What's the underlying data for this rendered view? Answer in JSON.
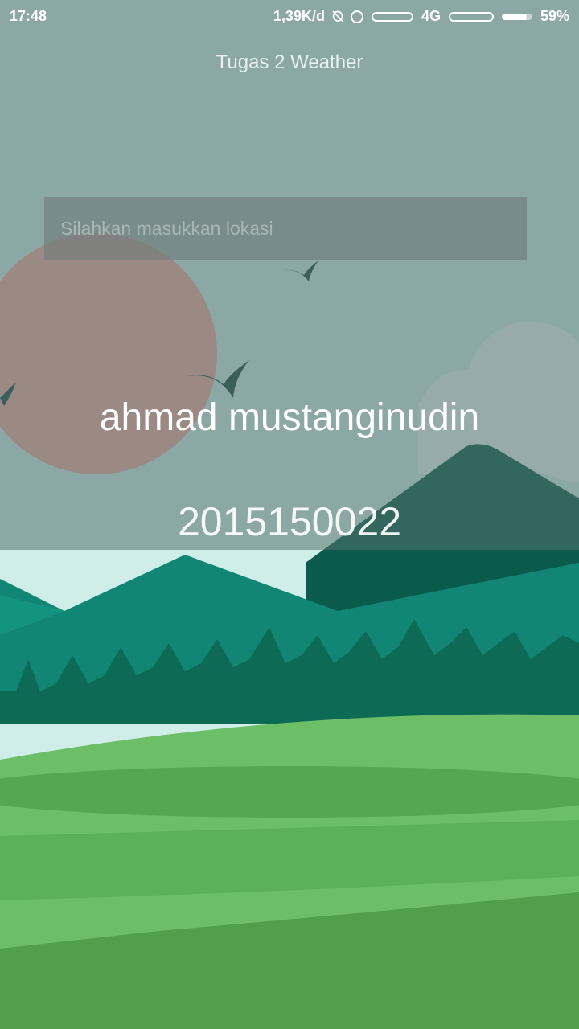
{
  "status_bar": {
    "time": "17:48",
    "network_speed": "1,39K/d",
    "network_type": "4G",
    "battery": "59%",
    "icons": [
      "mute-icon",
      "alarm-circle-icon",
      "signal-icon",
      "battery-icon"
    ]
  },
  "app": {
    "title": "Tugas 2 Weather"
  },
  "search": {
    "placeholder": "Silahkan masukkan lokasi",
    "value": ""
  },
  "profile": {
    "name": "ahmad mustanginudin",
    "student_id": "2015150022"
  },
  "colors": {
    "overlay": "#54706e",
    "sky": "#cfeee9",
    "mountain_dark": "#0f7a66",
    "mountain_far": "#0a5b4c",
    "grass_light": "#6cbf66",
    "grass_dark": "#4f9f4d",
    "text": "#ffffff"
  }
}
